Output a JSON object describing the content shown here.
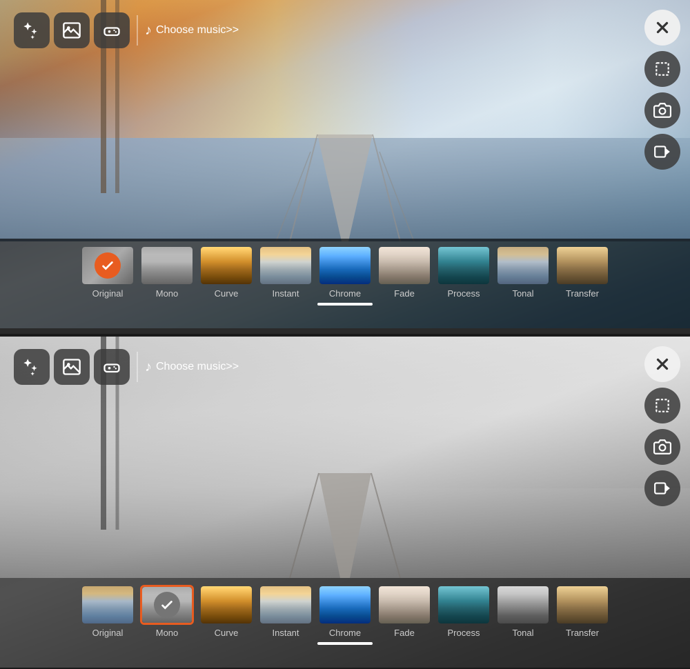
{
  "panels": [
    {
      "id": "top",
      "music_label": "Choose music>>",
      "toolbar_buttons": [
        "magic",
        "gallery",
        "gamepad"
      ],
      "right_buttons": [
        "close",
        "crop",
        "camera",
        "video"
      ],
      "filters": [
        {
          "id": "original",
          "label": "Original",
          "selected": true,
          "style": "original"
        },
        {
          "id": "mono",
          "label": "Mono",
          "style": "mono"
        },
        {
          "id": "curve",
          "label": "Curve",
          "style": "curve"
        },
        {
          "id": "instant",
          "label": "Instant",
          "style": "instant"
        },
        {
          "id": "chrome",
          "label": "Chrome",
          "style": "chrome"
        },
        {
          "id": "fade",
          "label": "Fade",
          "style": "fade"
        },
        {
          "id": "process",
          "label": "Process",
          "style": "process"
        },
        {
          "id": "tonal",
          "label": "Tonal",
          "style": "tonal"
        },
        {
          "id": "transfer",
          "label": "Transfer",
          "style": "transfer"
        }
      ]
    },
    {
      "id": "bottom",
      "music_label": "Choose music>>",
      "toolbar_buttons": [
        "magic",
        "gallery",
        "gamepad"
      ],
      "right_buttons": [
        "close",
        "crop",
        "camera",
        "video"
      ],
      "filters": [
        {
          "id": "original",
          "label": "Original",
          "selected": false,
          "style": "original"
        },
        {
          "id": "mono",
          "label": "Mono",
          "selected": true,
          "style": "mono"
        },
        {
          "id": "curve",
          "label": "Curve",
          "style": "curve"
        },
        {
          "id": "instant",
          "label": "Instant",
          "style": "instant"
        },
        {
          "id": "chrome",
          "label": "Chrome",
          "style": "chrome"
        },
        {
          "id": "fade",
          "label": "Fade",
          "style": "fade"
        },
        {
          "id": "process",
          "label": "Process",
          "style": "process"
        },
        {
          "id": "tonal",
          "label": "Tonal",
          "style": "tonal"
        },
        {
          "id": "transfer",
          "label": "Transfer",
          "style": "transfer"
        }
      ]
    }
  ]
}
